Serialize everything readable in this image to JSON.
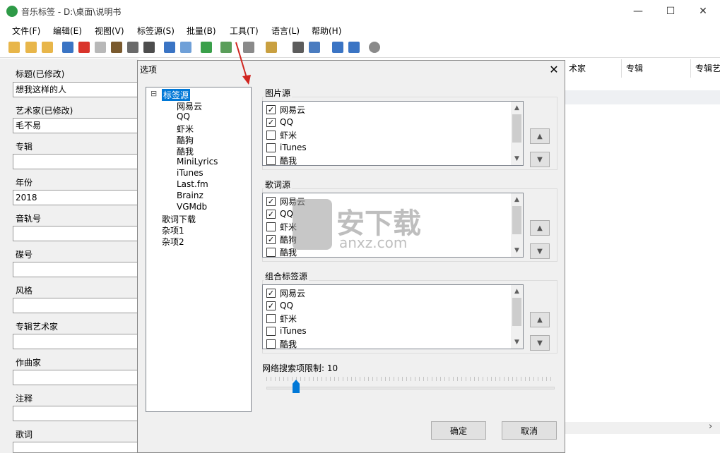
{
  "window": {
    "title": "音乐标签 - D:\\桌面\\说明书",
    "minimize_icon": "—",
    "maximize_icon": "☐",
    "close_icon": "✕"
  },
  "menu": [
    "文件(F)",
    "编辑(E)",
    "视图(V)",
    "标签源(S)",
    "批量(B)",
    "工具(T)",
    "语言(L)",
    "帮助(H)"
  ],
  "fields": [
    {
      "label": "标题(已修改)",
      "value": "想我这样的人"
    },
    {
      "label": "艺术家(已修改)",
      "value": "毛不易"
    },
    {
      "label": "专辑",
      "value": ""
    },
    {
      "label": "年份",
      "value": "2018"
    },
    {
      "label": "音轨号",
      "value": ""
    },
    {
      "label": "碟号",
      "value": ""
    },
    {
      "label": "风格",
      "value": ""
    },
    {
      "label": "专辑艺术家",
      "value": ""
    },
    {
      "label": "作曲家",
      "value": ""
    },
    {
      "label": "注释",
      "value": ""
    },
    {
      "label": "歌词",
      "value": ""
    }
  ],
  "columns": [
    "术家",
    "专辑",
    "专辑艺"
  ],
  "dialog": {
    "title": "选项",
    "close_icon": "✕",
    "tree": {
      "root": "标签源",
      "root_toggle": "⊟",
      "children": [
        "网易云",
        "QQ",
        "虾米",
        "酷狗",
        "酷我",
        "MiniLyrics",
        "iTunes",
        "Last.fm",
        "Brainz",
        "VGMdb"
      ],
      "siblings": [
        "歌词下载",
        "杂项1",
        "杂项2"
      ]
    },
    "groups": [
      {
        "title": "图片源",
        "items": [
          {
            "label": "网易云",
            "checked": true
          },
          {
            "label": "QQ",
            "checked": true
          },
          {
            "label": "虾米",
            "checked": false
          },
          {
            "label": "iTunes",
            "checked": false
          },
          {
            "label": "酷我",
            "checked": false
          }
        ]
      },
      {
        "title": "歌词源",
        "items": [
          {
            "label": "网易云",
            "checked": true
          },
          {
            "label": "QQ",
            "checked": true
          },
          {
            "label": "虾米",
            "checked": false
          },
          {
            "label": "酷狗",
            "checked": true
          },
          {
            "label": "酷我",
            "checked": false
          }
        ]
      },
      {
        "title": "组合标签源",
        "items": [
          {
            "label": "网易云",
            "checked": true
          },
          {
            "label": "QQ",
            "checked": true
          },
          {
            "label": "虾米",
            "checked": false
          },
          {
            "label": "iTunes",
            "checked": false
          },
          {
            "label": "酷我",
            "checked": false
          }
        ]
      }
    ],
    "up_icon": "▲",
    "down_icon": "▼",
    "check_glyph": "✓",
    "scroll_up": "▲",
    "scroll_down": "▼",
    "slider": {
      "label": "网络搜索项限制: 10",
      "value": 10
    },
    "ok": "确定",
    "cancel": "取消"
  },
  "watermark": {
    "cn": "安下载",
    "en": "anxz.com"
  },
  "hscroll_right": "›",
  "colors": {
    "app_icon": "#2e9a47",
    "accent": "#0078d7",
    "arrow": "#d0251f"
  }
}
